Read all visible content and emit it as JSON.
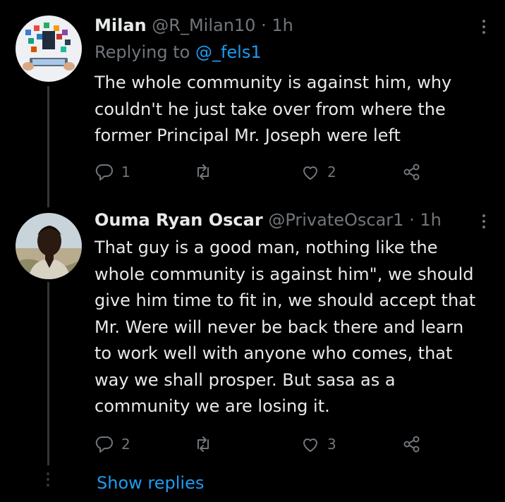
{
  "tweets": [
    {
      "name": "Milan",
      "handle": "@R_Milan10",
      "separator": "·",
      "time": "1h",
      "replying_prefix": "Replying to",
      "replying_to": "@_fels1",
      "text": "The whole community is against him, why\ncouldn't he just take over from where the\nformer Principal Mr. Joseph were left",
      "replies": "1",
      "retweets": "",
      "likes": "2"
    },
    {
      "name": "Ouma Ryan Oscar",
      "handle": "@PrivateOscar1",
      "separator": "·",
      "time": "1h",
      "text": "That guy is a good man, nothing like the\nwhole community is against him\", we should\ngive him time to fit in, we should  accept that\nMr. Were will never be back there and learn\nto work well with anyone who comes, that\nway we shall prosper. But sasa as a\ncommunity we are losing it.",
      "replies": "2",
      "retweets": "",
      "likes": "3"
    }
  ],
  "show_replies": "Show replies",
  "icons": {
    "reply": "reply-icon",
    "retweet": "retweet-icon",
    "like": "heart-icon",
    "share": "share-icon",
    "more": "more-options-icon"
  },
  "colors": {
    "background": "#000000",
    "text": "#e7e9ea",
    "muted": "#71767b",
    "accent": "#1d9bf0"
  }
}
